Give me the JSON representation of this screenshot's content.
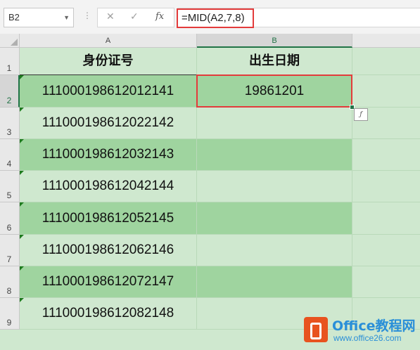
{
  "formula_bar": {
    "name_box": "B2",
    "cancel_glyph": "✕",
    "enter_glyph": "✓",
    "fx_label": "fx",
    "formula": "=MID(A2,7,8)"
  },
  "columns": [
    "A",
    "B"
  ],
  "rows": [
    {
      "num": "1",
      "a": "身份证号",
      "b": "出生日期"
    },
    {
      "num": "2",
      "a": "111000198612012141",
      "b": "19861201"
    },
    {
      "num": "3",
      "a": "111000198612022142",
      "b": ""
    },
    {
      "num": "4",
      "a": "111000198612032143",
      "b": ""
    },
    {
      "num": "5",
      "a": "111000198612042144",
      "b": ""
    },
    {
      "num": "6",
      "a": "111000198612052145",
      "b": ""
    },
    {
      "num": "7",
      "a": "111000198612062146",
      "b": ""
    },
    {
      "num": "8",
      "a": "111000198612072147",
      "b": ""
    },
    {
      "num": "9",
      "a": "111000198612082148",
      "b": ""
    }
  ],
  "selected_cell": "B2",
  "quick_analysis_icon": "flash-fill-options-icon",
  "watermark": {
    "title": "Office教程网",
    "url": "www.office26.com"
  },
  "colors": {
    "band_dark": "#9fd49f",
    "band_light": "#cfe8cf",
    "highlight_red": "#e33b3b",
    "excel_green": "#217346"
  }
}
